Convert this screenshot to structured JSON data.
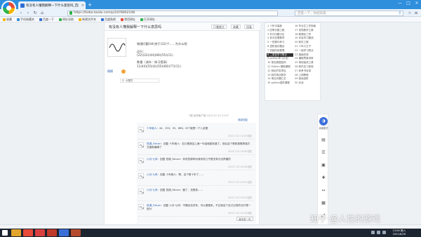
{
  "browser": {
    "tab_title": "有没有人懂我解释一下什么意思吗_百度贴吧",
    "tab_close": "×",
    "new_tab": "+",
    "window_buttons": [
      "—",
      "□",
      "×"
    ],
    "nav": [
      "‹",
      "›",
      "↻",
      "⌂"
    ],
    "url": "https://tieba.baidu.com/p/2478902108",
    "search_placeholder": "百度一下，你就知道",
    "search_icon": "search-icon",
    "address_right_icons": [
      "☆",
      "≡"
    ]
  },
  "bookmarks": [
    {
      "label": "收藏",
      "color": "#f4b400"
    },
    {
      "label": "手机收藏夹",
      "color": "#2f8fdc"
    },
    {
      "label": "百度一下",
      "color": "#2f6fd6"
    },
    {
      "label": "网址导航",
      "color": "#2fb34a"
    },
    {
      "label": "新建文件夹",
      "color": "#f4b400"
    },
    {
      "label": "百度贴吧",
      "color": "#2f6fd6"
    },
    {
      "label": "常用网址",
      "color": "#e84a3a"
    },
    {
      "label": "打开网址",
      "color": "#2fb34a"
    }
  ],
  "thread": {
    "title": "有没有人懂我解释一下什么意思吗",
    "buttons": [
      "只看楼主",
      "收藏",
      "回复"
    ],
    "op": {
      "name": "摸摸",
      "tip_label": "小尾巴",
      "text_lines": [
        "物理问题(44)关于(22)个……为什么呢",
        "",
        "运行：",
        "(22)(22)(44)(66)(55)(11)",
        "",
        "数量（流年：练习提高）",
        "11(44)(55)(4)(55)(66)(77)(11)"
      ],
      "meta": "3楼 贴吧客户端 2013-07-22 11:07",
      "reply_label": "收起回复"
    },
    "replies": [
      {
        "name": "十年碗人",
        "text": "44、333、55、666、677就是一个八卦图",
        "meta": "2013-7-22 11:49  回复"
      },
      {
        "name": "低调_Falcon",
        "text": "回复 十年碗人：自己看我这上面一句话就能知道了。然后这个是我按照简谱方式重新编辑了",
        "meta": "2013-7-22 13:56  回复"
      },
      {
        "name": "六月·七风",
        "text": "回复 低调_Falcon：你说的那种对我来说几乎是没有办法弄懂的",
        "meta": "2013-7-22 14:58  回复"
      },
      {
        "name": "六月·七风",
        "text": "回复 十年碗人：嗯。这个是十年了……",
        "meta": "2013-7-22 15:01  回复"
      },
      {
        "name": "六月·七风",
        "text": "回复 低调_Falcon：器了，没想到……",
        "meta": "2013-7-22 15:03  回复"
      },
      {
        "name": "低调_Falcon",
        "text": "回复 六月·七风：不懂也没关系，可以慢慢来。不过我这个自己记录的也只是一部分",
        "meta": "2013-7-22 14:18  回复"
      }
    ],
    "lzl_button": "我也说一句"
  },
  "chapters": {
    "left": [
      "1 少年中高度",
      "2 四季交替工程",
      "3 开口问题讨论",
      "4 多次定理推导",
      "5 一些赛尔练习",
      "6 进阶指引题目",
      "7 初始阶段整理",
      "8 二语言学习笔记",
      "9 python学习计划",
      "10 常见数据结构",
      "11 Python 基础课程",
      "12 网站开发项目",
      "13 软件算法数学",
      "14 常见问题汇总",
      "15 python进阶课程"
    ],
    "right": [
      "16 毕业生工作指南",
      "17 发现数学之美",
      "18 数理化三学",
      "19 手绘学习路线",
      "20 软件工程",
      "21 少年小王子",
      "22 一起学习算法",
      "23 指南完成",
      "24 编程思维训练",
      "25 常用高效工具",
      "26 软件实习体验",
      "27 参考书目录",
      "28 上网教程",
      "29 阅读进阶",
      "30 杂谈"
    ],
    "active_index": 7
  },
  "tools": {
    "mode_icon": "reading-mode-icon",
    "mode_glyph": "◑",
    "mode_label": "阅读模式",
    "items": [
      "▤",
      "☰",
      "▣",
      "✚",
      "↔",
      "▦",
      "⤢"
    ]
  },
  "watermark": "知乎 @人性的游戏",
  "taskbar": {
    "time": "13:06 周六",
    "date": "2021/6/26",
    "apps": [
      {
        "name": "explorer",
        "color": "#e2a42a"
      },
      {
        "name": "browser",
        "color": "#e84a3a"
      },
      {
        "name": "media",
        "color": "#d94040"
      },
      {
        "name": "office",
        "color": "#c0392b"
      },
      {
        "name": "chat",
        "color": "#3b6fd8"
      },
      {
        "name": "player",
        "color": "#b44b2e"
      }
    ]
  }
}
